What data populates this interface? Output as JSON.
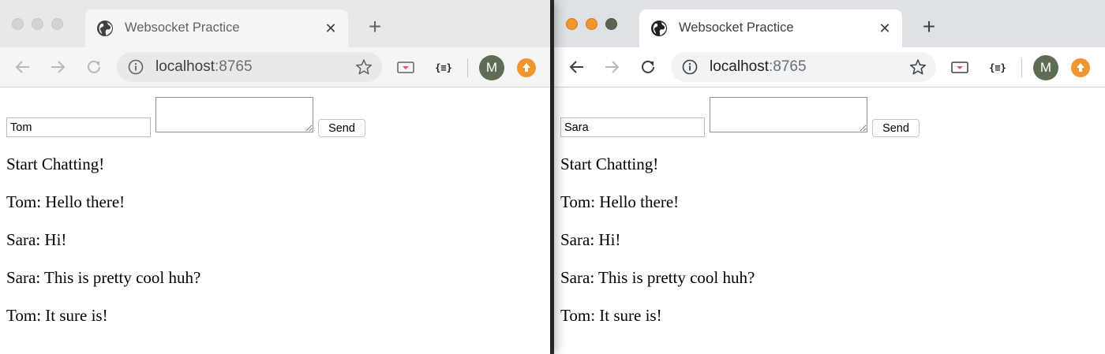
{
  "windows": [
    {
      "state": "inactive",
      "tab": {
        "title": "Websocket Practice",
        "close_symbol": "✕"
      },
      "new_tab_symbol": "+",
      "address": {
        "host": "localhost",
        "port": ":8765"
      },
      "extensions": {
        "json_formatter_label": "{≡}"
      },
      "profile": {
        "initial": "M"
      },
      "page": {
        "name_value": "Tom",
        "message_value": "",
        "send_label": "Send",
        "messages": [
          "Start Chatting!",
          "Tom: Hello there!",
          "Sara: Hi!",
          "Sara: This is pretty cool huh?",
          "Tom: It sure is!"
        ]
      }
    },
    {
      "state": "active",
      "tab": {
        "title": "Websocket Practice",
        "close_symbol": "✕"
      },
      "new_tab_symbol": "+",
      "address": {
        "host": "localhost",
        "port": ":8765"
      },
      "extensions": {
        "json_formatter_label": "{≡}"
      },
      "profile": {
        "initial": "M"
      },
      "page": {
        "name_value": "Sara",
        "message_value": "",
        "send_label": "Send",
        "messages": [
          "Start Chatting!",
          "Tom: Hello there!",
          "Sara: Hi!",
          "Sara: This is pretty cool huh?",
          "Tom: It sure is!"
        ]
      }
    }
  ],
  "icons": {
    "favicon": "globe-icon",
    "back": "arrow-left-icon",
    "forward": "arrow-right-icon",
    "reload": "reload-icon",
    "site_info": "info-circle-icon",
    "bookmark": "star-icon",
    "extension_1": "cast-extension-icon",
    "extension_2": "json-formatter-icon",
    "update": "update-arrow-icon"
  },
  "colors": {
    "update_badge": "#f0962e",
    "avatar": "#5e6b55",
    "traffic_red_active": "#f0962e",
    "traffic_green_active": "#5a6651"
  }
}
